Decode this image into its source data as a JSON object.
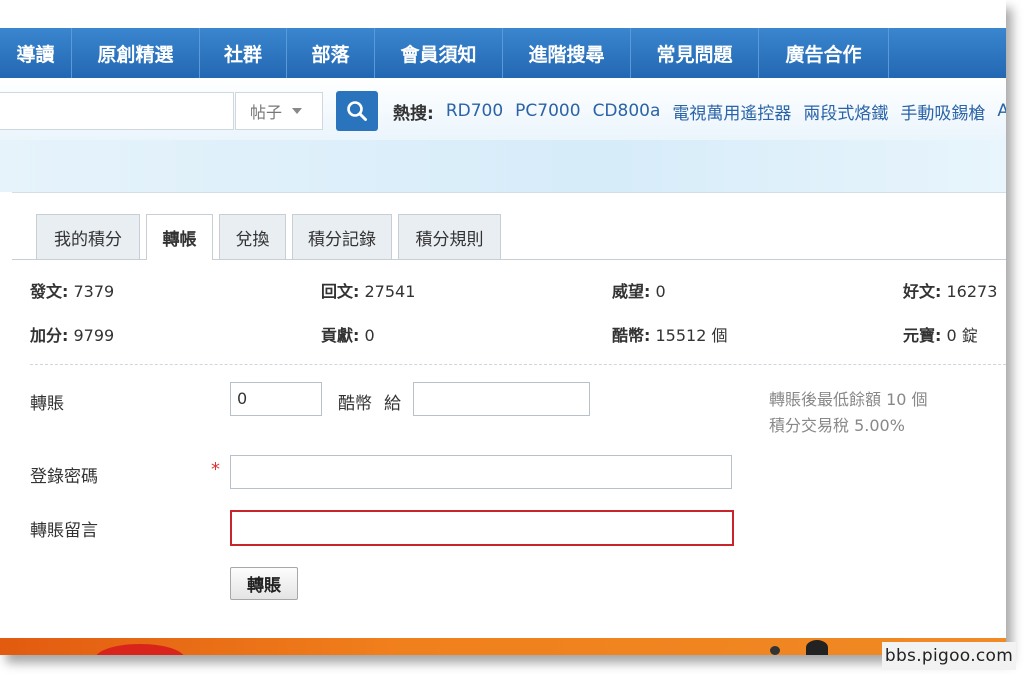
{
  "nav": {
    "items": [
      "導讀",
      "原創精選",
      "社群",
      "部落",
      "會員須知",
      "進階搜尋",
      "常見問題",
      "廣告合作"
    ]
  },
  "search": {
    "input_value": "",
    "type_selected": "帖子",
    "hot_label": "熱搜:",
    "hot_links": [
      "RD700",
      "PC7000",
      "CD800a",
      "電視萬用遙控器",
      "兩段式烙鐵",
      "手動吸錫槍",
      "AI"
    ]
  },
  "tabs": [
    "我的積分",
    "轉帳",
    "兌換",
    "積分記錄",
    "積分規則"
  ],
  "stats": [
    {
      "label": "發文:",
      "value": "7379"
    },
    {
      "label": "回文:",
      "value": "27541"
    },
    {
      "label": "威望:",
      "value": "0"
    },
    {
      "label": "好文:",
      "value": "16273"
    },
    {
      "label": "加分:",
      "value": "9799"
    },
    {
      "label": "貢獻:",
      "value": "0"
    },
    {
      "label": "酷幣:",
      "value": "15512 個"
    },
    {
      "label": "元寶:",
      "value": "0 錠"
    }
  ],
  "form": {
    "transfer_label": "轉賬",
    "amount_value": "0",
    "currency_text": "酷幣",
    "to_text": "給",
    "recipient_value": "",
    "hint_min_balance": "轉賬後最低餘額 10 個",
    "hint_tax": "積分交易稅 5.00%",
    "password_label": "登錄密碼",
    "required_mark": "*",
    "password_value": "",
    "message_label": "轉賬留言",
    "message_value": "",
    "submit_label": "轉賬"
  },
  "watermark": "bbs.pigoo.com",
  "colors": {
    "nav_bg": "#2a72bd",
    "link": "#2b63a8",
    "search_button": "#2a73bd",
    "required": "#d33333",
    "error_border": "#c8242c",
    "footer": "#ee7a1c"
  }
}
